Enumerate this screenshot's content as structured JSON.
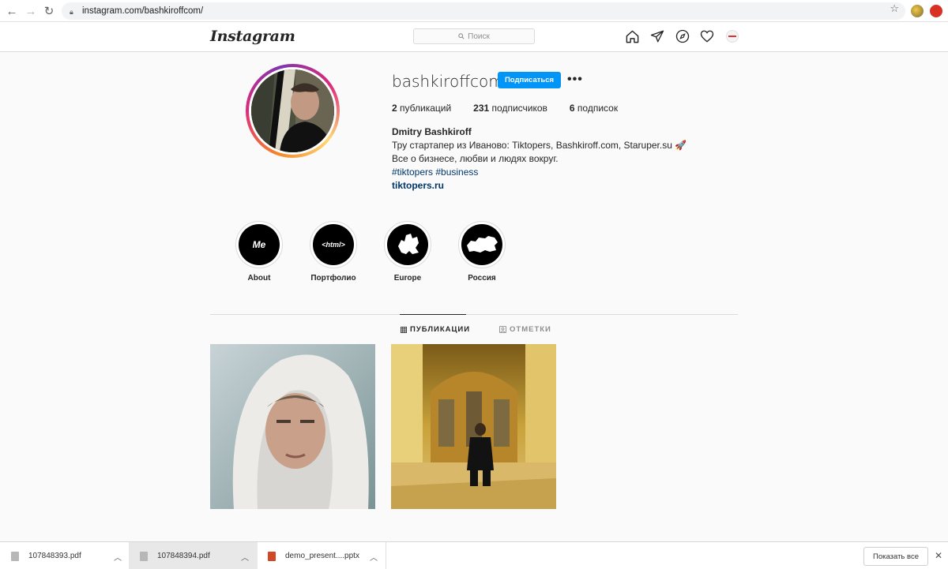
{
  "browser": {
    "url": "instagram.com/bashkiroffcom/"
  },
  "header": {
    "logo": "Instagram",
    "search_placeholder": "Поиск"
  },
  "profile": {
    "username": "bashkiroffcom",
    "follow_label": "Подписаться",
    "more_label": "•••",
    "stats": [
      {
        "count": "2",
        "label": " публикаций"
      },
      {
        "count": "231",
        "label": " подписчиков"
      },
      {
        "count": "6",
        "label": " подписок"
      }
    ],
    "name": "Dmitry Bashkiroff",
    "bio_line1": "Тру стартапер из Иваново: Tiktopers, Bashkiroff.com, Staruper.su 🚀",
    "bio_line2": "Все о бизнесе, любви и людях вокруг.",
    "hashtags": "#tiktopers #business",
    "website": "tiktopers.ru"
  },
  "highlights": [
    {
      "label": "About",
      "cover": "Me"
    },
    {
      "label": "Портфолио",
      "cover": "<html>"
    },
    {
      "label": "Europe",
      "cover": ""
    },
    {
      "label": "Россия",
      "cover": ""
    }
  ],
  "tabs": [
    {
      "label": "ПУБЛИКАЦИИ",
      "active": true
    },
    {
      "label": "ОТМЕТКИ",
      "active": false
    }
  ],
  "downloads": {
    "items": [
      {
        "name": "107848393.pdf"
      },
      {
        "name": "107848394.pdf"
      },
      {
        "name": "demo_present....pptx"
      }
    ],
    "show_all": "Показать все"
  },
  "colors": {
    "accent": "#0095f6",
    "link": "#00376b"
  }
}
